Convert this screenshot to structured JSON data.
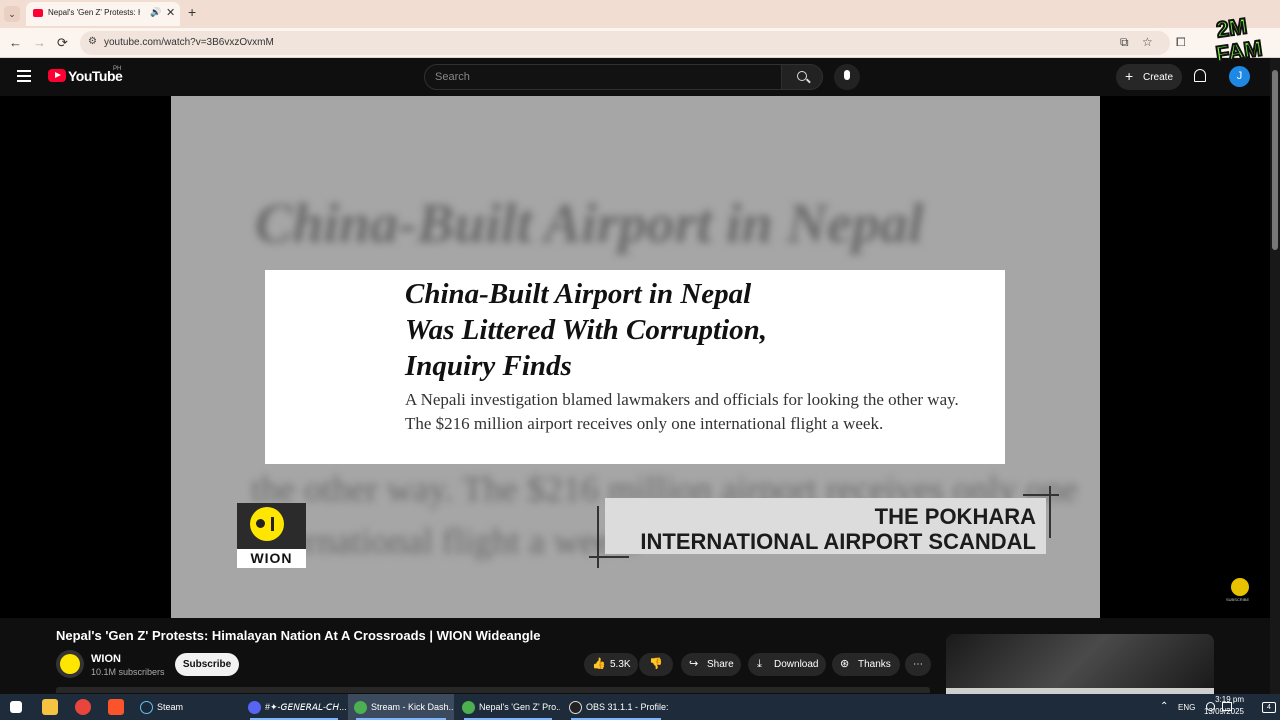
{
  "browser": {
    "tab_title": "Nepal's 'Gen Z' Protests: Him",
    "url": "youtube.com/watch?v=3B6vxzOvxmM",
    "tab_dropdown_icon": "chevron-down-icon",
    "new_tab_symbol": "+",
    "close_symbol": "✕",
    "speaker_symbol": "🔊",
    "nav": {
      "back": "←",
      "forward": "→",
      "reload": "⟳"
    },
    "right_icons": [
      "install-icon",
      "bookmark-star-icon",
      "extensions-icon"
    ]
  },
  "youtube": {
    "logo_text": "YouTube",
    "country_code": "PH",
    "search_placeholder": "Search",
    "create_label": "Create",
    "avatar_letter": "J"
  },
  "overlay_logo": {
    "line1": "2M",
    "line2": "FAM"
  },
  "video": {
    "bg_headline_1": "China-Built Airport in Nepal",
    "bg_text_1": "the other way. The $216 million airport receives only one",
    "bg_text_2": "international flight a week.",
    "card_headline": [
      "China-Built Airport in Nepal",
      "Was Littered With Corruption,",
      "Inquiry Finds"
    ],
    "card_dek": "A Nepali investigation blamed lawmakers and officials for looking the other way. The $216 million airport receives only one international flight a week.",
    "wion_logo_text": "WION",
    "lower_third": [
      "THE POKHARA",
      "INTERNATIONAL AIRPORT SCANDAL"
    ],
    "subscribe_badge_text": "SUBSCRIBE"
  },
  "meta": {
    "title": "Nepal's 'Gen Z' Protests: Himalayan Nation At A Crossroads | WION Wideangle",
    "channel_name": "WION",
    "subscribers": "10.1M subscribers",
    "subscribe_label": "Subscribe",
    "likes": "5.3K",
    "share_label": "Share",
    "download_label": "Download",
    "thanks_label": "Thanks",
    "more_symbol": "⋯"
  },
  "taskbar": {
    "items": [
      {
        "label": "Steam",
        "color": "#1b2838"
      },
      {
        "label": "#✦-𝘎𝘌𝘕𝘌𝘙𝘈𝘓-𝘊𝘏...",
        "color": "#5865f2"
      },
      {
        "label": "Stream - Kick Dash...",
        "color": "#4caf50"
      },
      {
        "label": "Nepal's 'Gen Z' Pro...",
        "color": "#4caf50"
      },
      {
        "label": "OBS 31.1.1 - Profile:...",
        "color": "#222222"
      }
    ],
    "lang": "ENG",
    "time": "3:19 pm",
    "date": "13/09/2025",
    "notif_count": "4"
  }
}
